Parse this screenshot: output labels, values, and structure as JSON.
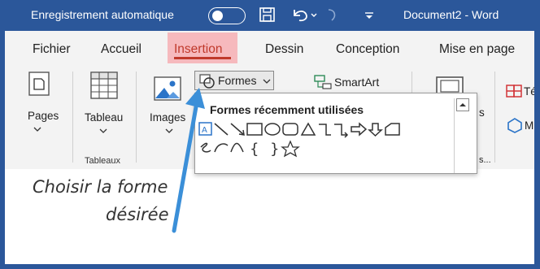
{
  "titlebar": {
    "autosave_label": "Enregistrement automatique",
    "doc_title": "Document2  -  Word"
  },
  "tabs": [
    "Fichier",
    "Accueil",
    "Insertion",
    "Dessin",
    "Conception",
    "Mise en page"
  ],
  "ribbon": {
    "pages_label": "Pages",
    "tableau_label": "Tableau",
    "tableaux_group": "Tableaux",
    "images_label": "Images",
    "formes_label": "Formes",
    "smartart_label": "SmartArt",
    "cut_s_label": "s",
    "cut_s2_label": "s...",
    "tel_label": "Tél",
    "m_label": "M"
  },
  "dropdown": {
    "header": "Formes récemment utilisées"
  },
  "annotation": {
    "line1": "Choisir la forme",
    "line2": "désirée"
  },
  "colors": {
    "accent": "#2b579a",
    "active_tab_bg": "#f6b9bd",
    "active_tab_text": "#c0392b",
    "arrow": "#3b8fd8"
  }
}
